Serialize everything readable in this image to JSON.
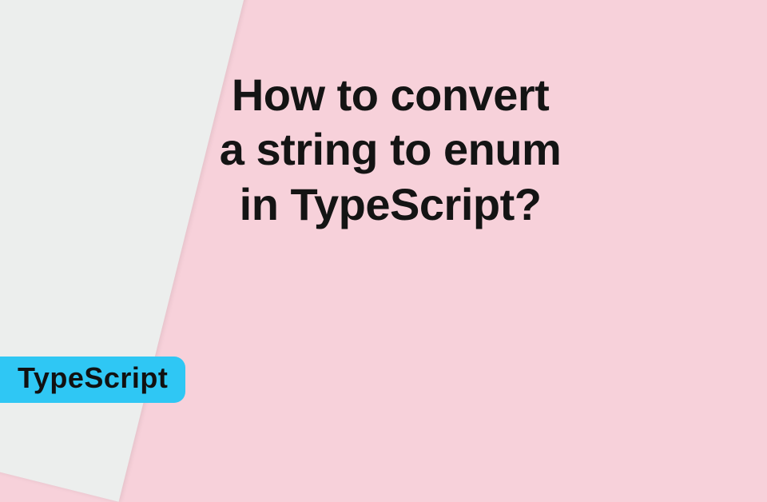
{
  "heading": {
    "line1": "How to convert",
    "line2": "a string to enum",
    "line3": "in TypeScript?"
  },
  "badge": {
    "label": "TypeScript"
  },
  "colors": {
    "panel_pink": "#f7d1da",
    "panel_grey": "#eceeed",
    "badge_cyan": "#2fc7f4",
    "text": "#141414"
  }
}
